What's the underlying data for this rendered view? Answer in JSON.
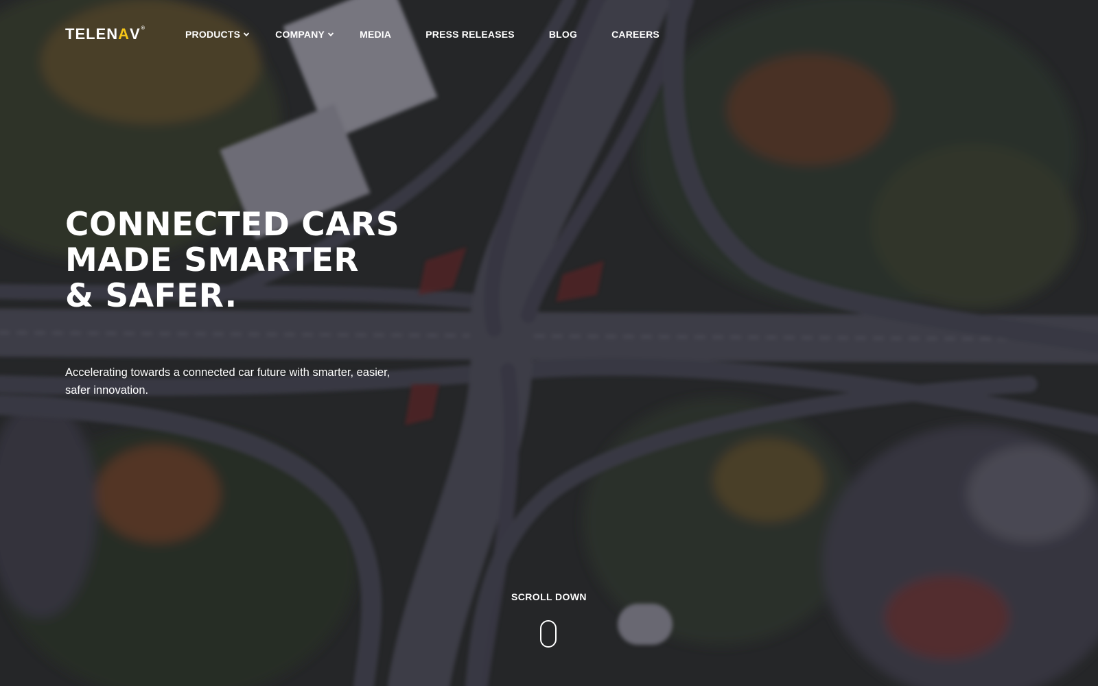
{
  "brand": {
    "name_part1": "TELEN",
    "name_accent": "A",
    "name_part2": "V",
    "tm": "®",
    "accent_color": "#f5c518"
  },
  "nav": {
    "items": [
      {
        "label": "PRODUCTS",
        "dropdown": true
      },
      {
        "label": "COMPANY",
        "dropdown": true
      },
      {
        "label": "MEDIA",
        "dropdown": false
      },
      {
        "label": "PRESS RELEASES",
        "dropdown": false
      },
      {
        "label": "BLOG",
        "dropdown": false
      },
      {
        "label": "CAREERS",
        "dropdown": false
      }
    ]
  },
  "hero": {
    "headline_lines": [
      "CONNECTED CARS",
      "MADE SMARTER",
      "& SAFER."
    ],
    "subcopy": "Accelerating towards a connected car future with smarter, easier, safer innovation.",
    "background_description_icon": "aerial-highway-interchange-image"
  },
  "scroll": {
    "label": "SCROLL DOWN",
    "icon": "mouse-icon"
  },
  "colors": {
    "overlay": "#1c1a2c",
    "text": "#ffffff"
  }
}
